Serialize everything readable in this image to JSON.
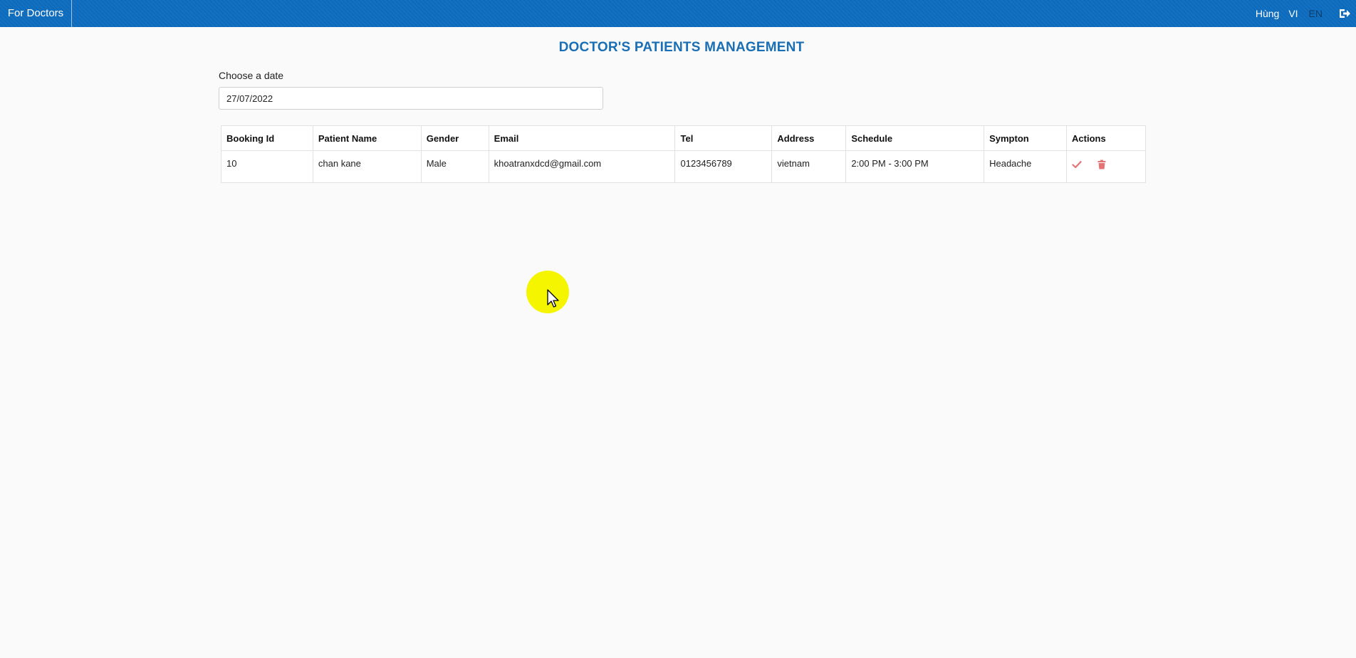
{
  "topbar": {
    "brand": "For Doctors",
    "username": "Hùng",
    "lang_vi": "VI",
    "lang_en": "EN",
    "logout_icon": "sign-out-icon",
    "background_color": "#0d6cbf"
  },
  "main": {
    "title": "DOCTOR'S PATIENTS MANAGEMENT",
    "title_color": "#1a6fb4",
    "date_label": "Choose a date",
    "date_value": "27/07/2022"
  },
  "table": {
    "headers": [
      "Booking Id",
      "Patient Name",
      "Gender",
      "Email",
      "Tel",
      "Address",
      "Schedule",
      "Sympton",
      "Actions"
    ],
    "rows": [
      {
        "booking_id": "10",
        "patient_name": "chan kane",
        "gender": "Male",
        "email": "khoatranxdcd@gmail.com",
        "tel": "0123456789",
        "address": "vietnam",
        "schedule": "2:00 PM - 3:00 PM",
        "sympton": "Headache",
        "actions": [
          "confirm-check-icon",
          "delete-trash-icon"
        ]
      }
    ],
    "action_color": "#e57373"
  }
}
